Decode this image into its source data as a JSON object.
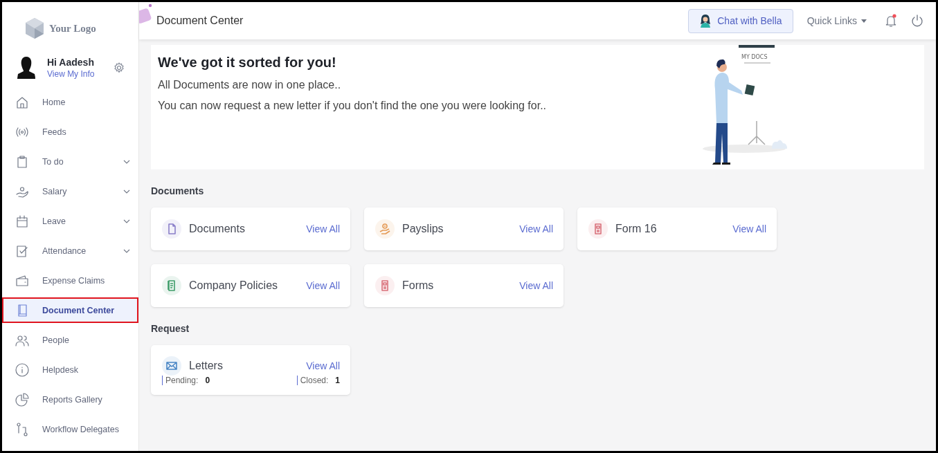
{
  "logo": {
    "text": "Your Logo"
  },
  "user": {
    "greeting": "Hi Aadesh",
    "link": "View My Info"
  },
  "sidebar": {
    "items": [
      {
        "label": "Home",
        "expandable": false,
        "selected": false
      },
      {
        "label": "Feeds",
        "expandable": false,
        "selected": false
      },
      {
        "label": "To do",
        "expandable": true,
        "selected": false
      },
      {
        "label": "Salary",
        "expandable": true,
        "selected": false
      },
      {
        "label": "Leave",
        "expandable": true,
        "selected": false
      },
      {
        "label": "Attendance",
        "expandable": true,
        "selected": false
      },
      {
        "label": "Expense Claims",
        "expandable": false,
        "selected": false
      },
      {
        "label": "Document Center",
        "expandable": false,
        "selected": true
      },
      {
        "label": "People",
        "expandable": false,
        "selected": false
      },
      {
        "label": "Helpdesk",
        "expandable": false,
        "selected": false
      },
      {
        "label": "Reports Gallery",
        "expandable": false,
        "selected": false
      },
      {
        "label": "Workflow Delegates",
        "expandable": false,
        "selected": false
      }
    ]
  },
  "header": {
    "title": "Document Center",
    "chat_button": "Chat with Bella",
    "quick_links": "Quick Links",
    "notifications_unread": true
  },
  "banner": {
    "title": "We've got it sorted for you!",
    "lines": [
      "All Documents are now in one place..",
      "You can now request a new letter if you don't find the one you were looking for.."
    ],
    "sign_text": "MY DOCS"
  },
  "sections": [
    {
      "title": "Documents",
      "cards": [
        {
          "kind": "link",
          "title": "Documents",
          "link": "View All",
          "color": "#8a7fc9"
        },
        {
          "kind": "link",
          "title": "Payslips",
          "link": "View All",
          "color": "#e59a55"
        },
        {
          "kind": "link",
          "title": "Form 16",
          "link": "View All",
          "color": "#d9707a"
        },
        {
          "kind": "link",
          "title": "Company Policies",
          "link": "View All",
          "color": "#3f9d6a"
        },
        {
          "kind": "link",
          "title": "Forms",
          "link": "View All",
          "color": "#d9707a"
        }
      ]
    },
    {
      "title": "Request",
      "cards": [
        {
          "kind": "request",
          "title": "Letters",
          "link": "View All",
          "color": "#4a86c5",
          "stats": [
            {
              "label": "Pending:",
              "value": "0"
            },
            {
              "label": "Closed:",
              "value": "1"
            }
          ]
        }
      ]
    }
  ]
}
